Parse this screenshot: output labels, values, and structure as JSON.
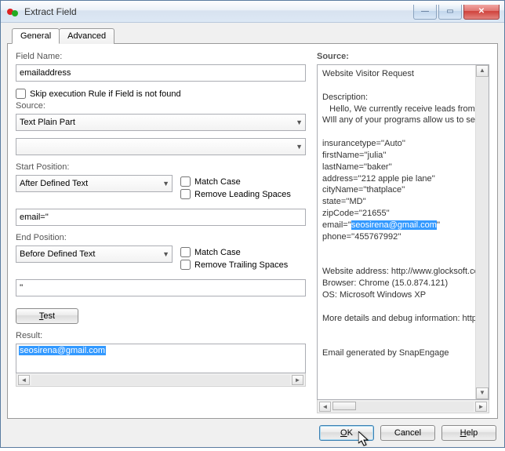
{
  "window": {
    "title": "Extract Field"
  },
  "tabs": {
    "general": "General",
    "advanced": "Advanced"
  },
  "labels": {
    "field_name": "Field Name:",
    "source": "Source:",
    "start_position": "Start Position:",
    "end_position": "End Position:",
    "result": "Result:",
    "source_panel": "Source:"
  },
  "fields": {
    "field_name_value": "emailaddress",
    "skip_rule": "Skip execution Rule if Field is not found",
    "source_select": "Text Plain Part",
    "secondary_select": "",
    "start_pos_select": "After Defined Text",
    "start_text_value": "email=''",
    "end_pos_select": "Before Defined Text",
    "end_text_value": "''",
    "match_case": "Match Case",
    "remove_leading": "Remove Leading Spaces",
    "remove_trailing": "Remove Trailing Spaces"
  },
  "buttons": {
    "test": "Test",
    "ok": "OK",
    "cancel": "Cancel",
    "help": "Help"
  },
  "result_value": "seosirena@gmail.com",
  "source_preview": {
    "l1": "Website Visitor Request",
    "l2": "Description:",
    "l3": "   Hello, We currently receive leads from a lea",
    "l4": "WIll any of your programs allow us to set a ru",
    "l5": "insurancetype=''Auto''",
    "l6": "firstName=''julia''",
    "l7": "lastName=''baker''",
    "l8": "address=''212 apple pie lane''",
    "l9": "cityName=''thatplace''",
    "l10": "state=''MD''",
    "l11": "zipCode=''21655''",
    "l12a": "email=''",
    "l12b": "seosirena@gmail.com",
    "l12c": "''",
    "l13": "phone=''455767992''",
    "l14": "Website address: http://www.glocksoft.com",
    "l15": "Browser: Chrome (15.0.874.121)",
    "l16": "OS: Microsoft Windows XP",
    "l17": "More details and debug information: http://v",
    "l18": "Email generated by SnapEngage"
  }
}
